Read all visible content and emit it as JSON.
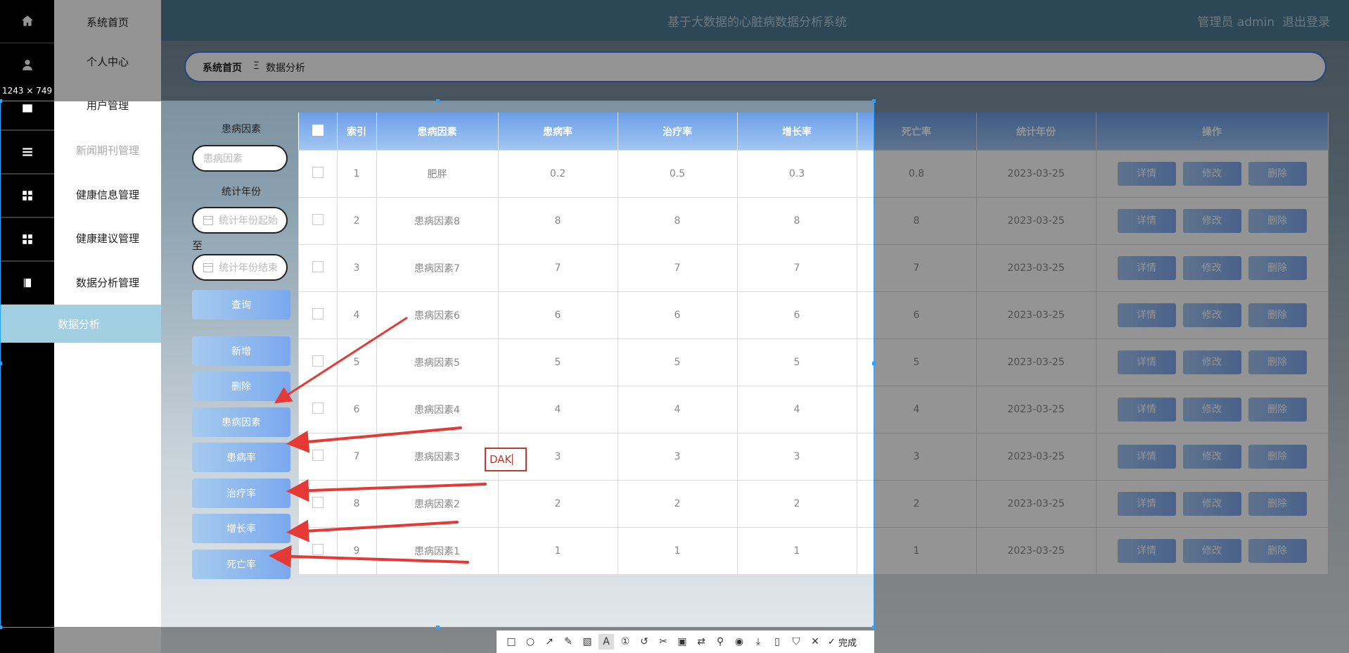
{
  "header": {
    "title": "基于大数据的心脏病数据分析系统",
    "user": "管理员 admin",
    "logout": "退出登录"
  },
  "breadcrumb": {
    "home": "系统首页",
    "separator": "Ξ",
    "current": "数据分析"
  },
  "sidebar": {
    "items": [
      {
        "label": "系统首页",
        "icon": "home-icon"
      },
      {
        "label": "个人中心",
        "icon": "user-icon"
      },
      {
        "label": "用户管理",
        "icon": "users-icon"
      },
      {
        "label": "新闻期刊管理",
        "icon": "list-icon"
      },
      {
        "label": "健康信息管理",
        "icon": "grid-icon"
      },
      {
        "label": "健康建议管理",
        "icon": "grid-icon"
      },
      {
        "label": "数据分析管理",
        "icon": "book-icon"
      }
    ],
    "active_sub": "数据分析"
  },
  "filters": {
    "factor_label": "患病因素",
    "factor_placeholder": "患病因素",
    "year_label": "统计年份",
    "year_start_placeholder": "统计年份起始",
    "to": "至",
    "year_end_placeholder": "统计年份结束",
    "query": "查询"
  },
  "side_buttons": [
    "新增",
    "删除",
    "患病因素",
    "患病率",
    "治疗率",
    "增长率",
    "死亡率"
  ],
  "table": {
    "headers": [
      "索引",
      "患病因素",
      "患病率",
      "治疗率",
      "增长率",
      "死亡率",
      "统计年份",
      "操作"
    ],
    "rows": [
      [
        "1",
        "肥胖",
        "0.2",
        "0.5",
        "0.3",
        "0.8",
        "2023-03-25"
      ],
      [
        "2",
        "患病因素8",
        "8",
        "8",
        "8",
        "8",
        "2023-03-25"
      ],
      [
        "3",
        "患病因素7",
        "7",
        "7",
        "7",
        "7",
        "2023-03-25"
      ],
      [
        "4",
        "患病因素6",
        "6",
        "6",
        "6",
        "6",
        "2023-03-25"
      ],
      [
        "5",
        "患病因素5",
        "5",
        "5",
        "5",
        "5",
        "2023-03-25"
      ],
      [
        "6",
        "患病因素4",
        "4",
        "4",
        "4",
        "4",
        "2023-03-25"
      ],
      [
        "7",
        "患病因素3",
        "3",
        "3",
        "3",
        "3",
        "2023-03-25"
      ],
      [
        "8",
        "患病因素2",
        "2",
        "2",
        "2",
        "2",
        "2023-03-25"
      ],
      [
        "9",
        "患病因素1",
        "1",
        "1",
        "1",
        "1",
        "2023-03-25"
      ]
    ],
    "ops": [
      "详情",
      "修改",
      "删除"
    ]
  },
  "screenshot_tool": {
    "size_badge": "1243 × 749",
    "text_annotation": "DAK",
    "done_label": "完成",
    "annotation_color": "#e53935"
  }
}
